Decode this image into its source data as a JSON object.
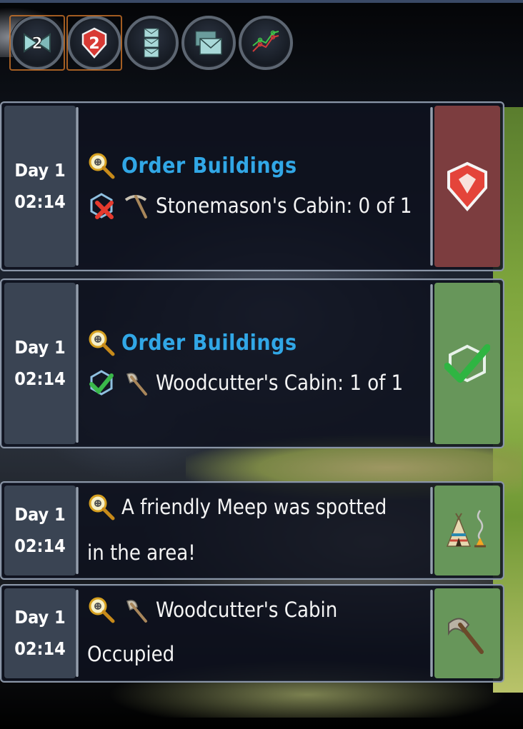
{
  "top_bar": {
    "buttons": [
      {
        "name": "swords-icon",
        "badge": "2"
      },
      {
        "name": "alert-icon",
        "badge": "2"
      },
      {
        "name": "mail-stack-icon"
      },
      {
        "name": "mail-icon"
      },
      {
        "name": "statistics-icon"
      }
    ]
  },
  "messages": [
    {
      "day": "Day 1",
      "time": "02:14",
      "title": "Order Buildings",
      "detail": "Stonemason's Cabin: 0 of 1",
      "status": "failed",
      "status_color": "#7c3d3f"
    },
    {
      "day": "Day 1",
      "time": "02:14",
      "title": "Order Buildings",
      "detail": "Woodcutter's Cabin: 1 of 1",
      "status": "completed",
      "status_color": "#67965a"
    },
    {
      "day": "Day 1",
      "time": "02:14",
      "text_line1": "A friendly Meep was spotted",
      "text_line2": "in the area!",
      "status_color": "#67965a"
    },
    {
      "day": "Day 1",
      "time": "02:14",
      "text_line1": "Woodcutter's Cabin",
      "text_line2": "Occupied",
      "status_color": "#67965a"
    }
  ],
  "colors": {
    "title_blue": "#31a7e6",
    "date_panel": "#3a4453",
    "card_border": "#8b96a7"
  }
}
